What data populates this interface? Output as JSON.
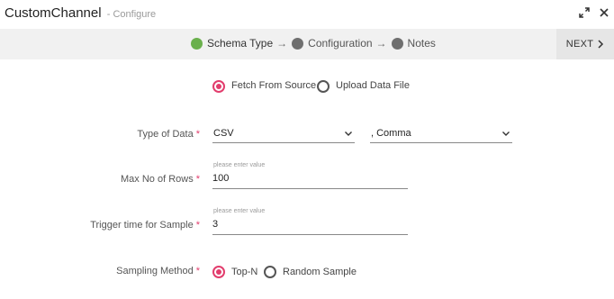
{
  "window": {
    "title": "CustomChannel",
    "subtitle": "- Configure",
    "expand_icon": "expand-icon",
    "close_icon": "close-icon"
  },
  "steps": [
    {
      "label": "Schema Type",
      "status": "complete"
    },
    {
      "label": "Configuration",
      "status": "pending"
    },
    {
      "label": "Notes",
      "status": "pending"
    }
  ],
  "step_arrow": "→",
  "next_button": {
    "label": "NEXT",
    "icon": "chevron-right-icon"
  },
  "source": {
    "options": [
      "Fetch From Source",
      "Upload Data File"
    ],
    "selected": "Fetch From Source"
  },
  "form": {
    "type_of_data": {
      "label": "Type of Data",
      "required_mark": "*",
      "value": "CSV",
      "delimiter": ", Comma"
    },
    "max_rows": {
      "label": "Max No of Rows",
      "required_mark": "*",
      "hint": "please enter value",
      "value": "100"
    },
    "trigger_time": {
      "label": "Trigger time for Sample",
      "required_mark": "*",
      "hint": "please enter value",
      "value": "3"
    },
    "sampling": {
      "label": "Sampling Method",
      "required_mark": "*",
      "options": [
        "Top-N",
        "Random Sample"
      ],
      "selected": "Top-N"
    }
  },
  "colors": {
    "accent": "#e23d6d",
    "step_complete": "#6ab04c",
    "step_pending": "#6f6f6f",
    "stepbar_bg": "#f1f1f1"
  }
}
